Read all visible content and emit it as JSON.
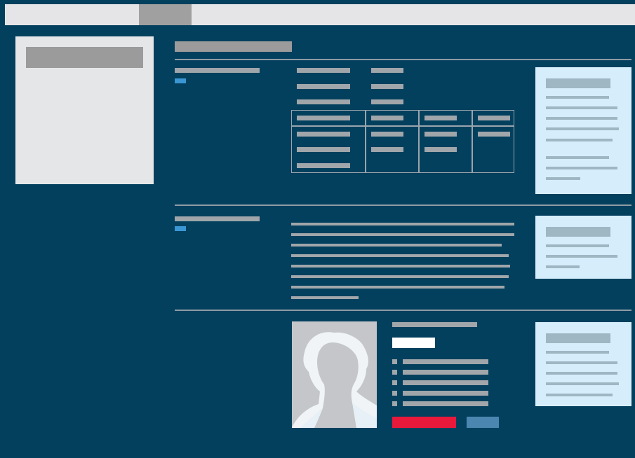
{
  "colors": {
    "background": "#03405e",
    "panel": "#e5e6e8",
    "note_bg": "#d6eefc",
    "accent_blue": "#3b97d3",
    "cta_red": "#e8193b",
    "cta_blue": "#4a86b0",
    "white_button": "#ffffff"
  },
  "top_nav": {
    "tabs": [
      "",
      ""
    ]
  },
  "sidebar": {
    "title": ""
  },
  "page": {
    "title": ""
  },
  "sections": [
    {
      "heading": "",
      "note": {
        "heading": "",
        "text": ""
      }
    },
    {
      "heading": "",
      "body": "",
      "note": {
        "heading": "",
        "text": ""
      }
    },
    {
      "profile": {
        "name": "",
        "action_label": "",
        "list_items": [
          "",
          "",
          "",
          "",
          ""
        ],
        "primary_button": "",
        "secondary_button": ""
      },
      "note": {
        "heading": "",
        "text": ""
      }
    }
  ],
  "icons": {
    "portrait": "portrait-silhouette-icon"
  }
}
